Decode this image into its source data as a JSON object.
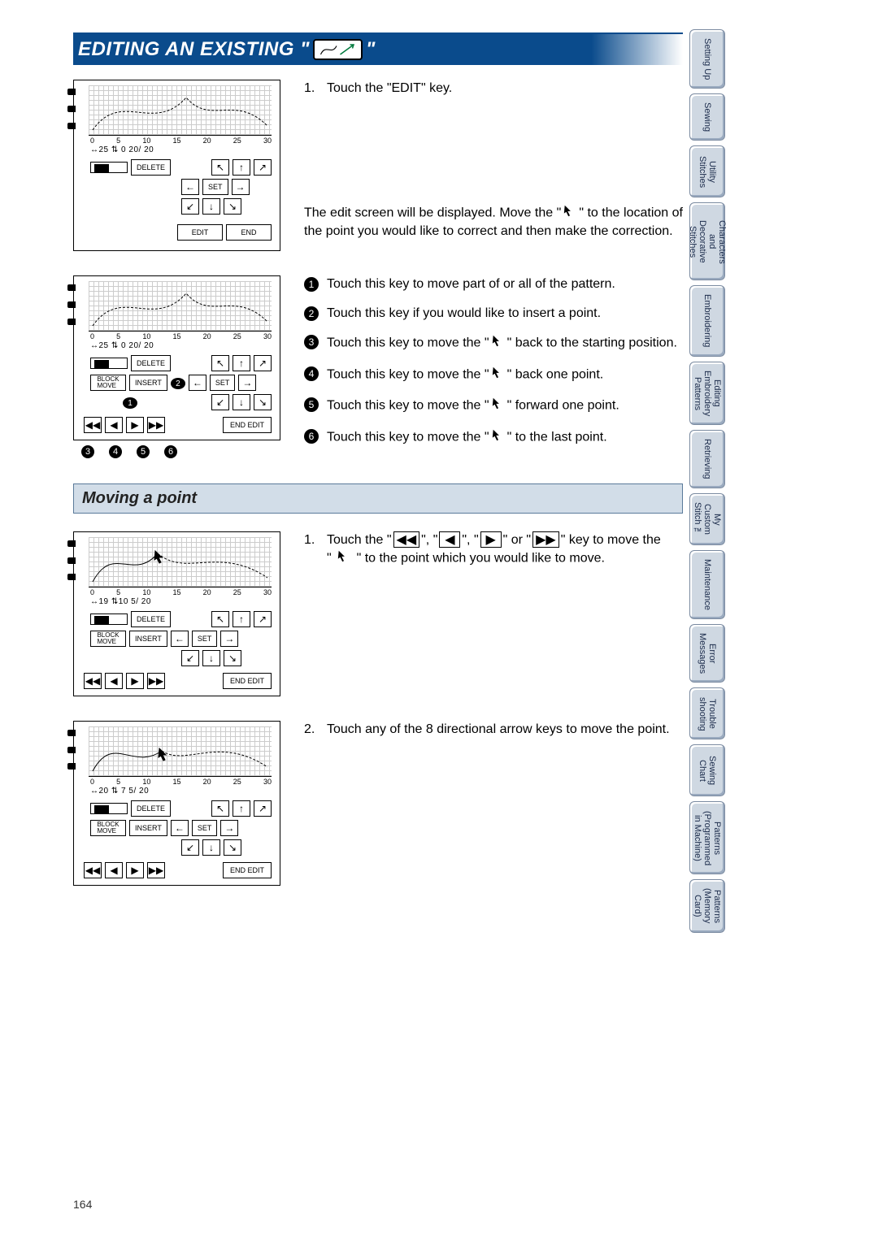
{
  "title": {
    "prefix": "EDITING AN EXISTING \" ",
    "suffix": " \""
  },
  "section1": {
    "step1_num": "1.",
    "step1_text": "Touch the \"EDIT\" key.",
    "desc": "The edit screen will be displayed. Move the \"  \" to the location of the point you would like to correct and then make the correction.",
    "screen1": {
      "ruler": [
        "0",
        "5",
        "10",
        "15",
        "20",
        "25",
        "30"
      ],
      "stats": "↔25 ⇅ 0    20/ 20",
      "delete": "DELETE",
      "set": "SET",
      "edit": "EDIT",
      "end": "END"
    },
    "screen2": {
      "ruler": [
        "0",
        "5",
        "10",
        "15",
        "20",
        "25",
        "30"
      ],
      "stats": "↔25 ⇅ 0    20/ 20",
      "delete": "DELETE",
      "block_move": "BLOCK\nMOVE",
      "insert": "INSERT",
      "set": "SET",
      "end_edit": "END EDIT"
    },
    "items": {
      "1": "Touch this key to move part of or all of the pattern.",
      "2": "Touch this key if you would like to insert a point.",
      "3": "Touch this key to move the \"  \" back to the starting position.",
      "4": "Touch this key to move the \"  \" back one point.",
      "5": "Touch this key to move the \"  \" forward one point.",
      "6": "Touch this key to move the \"  \" to the last point."
    }
  },
  "section2": {
    "heading": "Moving a point",
    "step1_num": "1.",
    "step1_a": "Touch the \"",
    "step1_b": "\", \"",
    "step1_c": "\", \"",
    "step1_d": "\" or \"",
    "step1_e": "\" key to move the",
    "step1_line2a": "\" ",
    "step1_line2b": " \" to the point which you would like to move.",
    "step2_num": "2.",
    "step2_text": "Touch any of the 8 directional arrow keys to move the point.",
    "screen3": {
      "ruler": [
        "0",
        "5",
        "10",
        "15",
        "20",
        "25",
        "30"
      ],
      "stats": "↔19 ⇅10     5/ 20",
      "delete": "DELETE",
      "block_move": "BLOCK\nMOVE",
      "insert": "INSERT",
      "set": "SET",
      "end_edit": "END EDIT"
    },
    "screen4": {
      "ruler": [
        "0",
        "5",
        "10",
        "15",
        "20",
        "25",
        "30"
      ],
      "stats": "↔20 ⇅ 7     5/ 20",
      "delete": "DELETE",
      "block_move": "BLOCK\nMOVE",
      "insert": "INSERT",
      "set": "SET",
      "end_edit": "END EDIT"
    }
  },
  "tabs": [
    "Setting Up",
    "Sewing",
    "Utility\nStitches",
    "Characters\nand\nDecorative\nStitches",
    "Embroidering",
    "Editing\nEmbroidery\nPatterns",
    "Retrieving",
    "My\nCustom\nStitch ™",
    "Maintenance",
    "Error\nMessages",
    "Trouble\nshooting",
    "Sewing\nChart",
    "Patterns\n(Programmed\nin Machine)",
    "Patterns\n(Memory\nCard)"
  ],
  "page_number": "164",
  "arrows": {
    "nw": "↖",
    "n": "↑",
    "ne": "↗",
    "w": "←",
    "e": "→",
    "sw": "↙",
    "s": "↓",
    "se": "↘",
    "first": "◀◀",
    "prev": "◀",
    "next": "▶",
    "last": "▶▶"
  },
  "callouts": [
    "1",
    "2",
    "3",
    "4",
    "5",
    "6"
  ]
}
